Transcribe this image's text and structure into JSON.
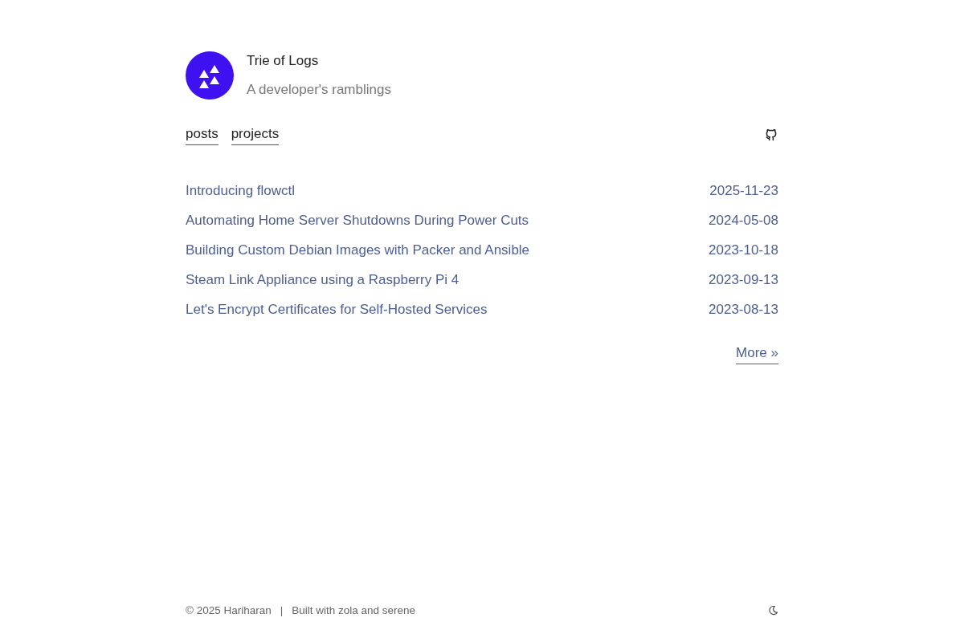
{
  "header": {
    "title": "Trie of Logs",
    "subtitle": "A developer's ramblings"
  },
  "nav": {
    "links": [
      {
        "label": "posts"
      },
      {
        "label": "projects"
      }
    ]
  },
  "posts": [
    {
      "title": "Introducing flowctl",
      "date": "2025-11-23"
    },
    {
      "title": "Automating Home Server Shutdowns During Power Cuts",
      "date": "2024-05-08"
    },
    {
      "title": "Building Custom Debian Images with Packer and Ansible",
      "date": "2023-10-18"
    },
    {
      "title": "Steam Link Appliance using a Raspberry Pi 4",
      "date": "2023-09-13"
    },
    {
      "title": "Let's Encrypt Certificates for Self-Hosted Services",
      "date": "2023-08-13"
    }
  ],
  "more_link": "More »",
  "footer": {
    "copyright": "© 2025 Hariharan",
    "separator": "|",
    "credit": "Built with zola and serene"
  }
}
